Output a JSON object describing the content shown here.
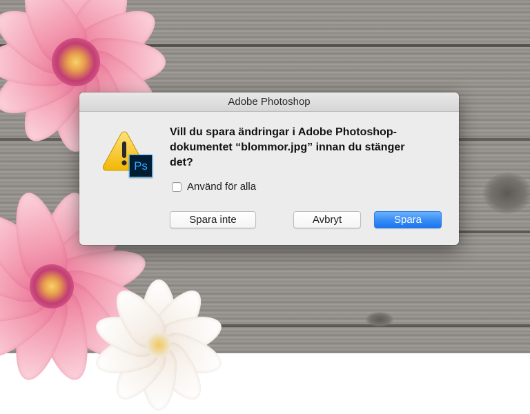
{
  "dialog": {
    "title": "Adobe Photoshop",
    "message_line1": "Vill du spara ändringar i Adobe Photoshop-",
    "message_line2": "dokumentet “blommor.jpg” innan du stänger",
    "message_line3": "det?",
    "checkbox": {
      "label": "Använd för alla",
      "checked": false
    },
    "buttons": {
      "dont_save": "Spara inte",
      "cancel": "Avbryt",
      "save": "Spara"
    },
    "app_badge": "Ps",
    "icon": "warning-icon"
  },
  "colors": {
    "accent_button": "#3a8ff5",
    "ps_badge_bg": "#001d34",
    "ps_badge_fg": "#31a8ff",
    "warning_yellow": "#f7c928"
  }
}
